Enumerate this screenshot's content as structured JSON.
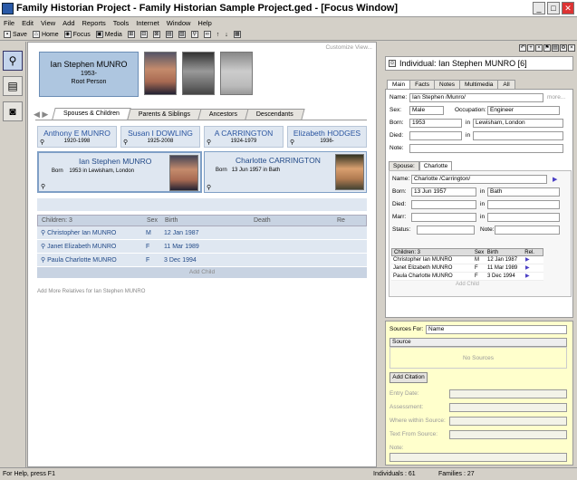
{
  "window": {
    "title": "Family Historian Project - Family Historian Sample Project.ged - [Focus Window]"
  },
  "menu": [
    "File",
    "Edit",
    "View",
    "Add",
    "Reports",
    "Tools",
    "Internet",
    "Window",
    "Help"
  ],
  "toolbar": {
    "save": "Save",
    "home": "Home",
    "focus": "Focus",
    "media": "Media"
  },
  "main": {
    "customize": "Customize View...",
    "focus": {
      "name": "Ian Stephen MUNRO",
      "dates": "1953-",
      "role": "Root Person"
    },
    "tabs": [
      "Spouses & Children",
      "Parents & Siblings",
      "Ancestors",
      "Descendants"
    ],
    "grandparents": [
      {
        "name": "Anthony E MUNRO",
        "dates": "1920-1998"
      },
      {
        "name": "Susan I DOWLING",
        "dates": "1925-2008"
      },
      {
        "name": "A CARRINGTON",
        "dates": "1924-1979"
      },
      {
        "name": "Elizabeth HODGES",
        "dates": "1936-"
      }
    ],
    "person": {
      "name": "Ian Stephen MUNRO",
      "born_label": "Born",
      "born": "1953 in Lewisham, London"
    },
    "spouse": {
      "name": "Charlotte CARRINGTON",
      "born_label": "Born",
      "born": "13 Jun 1957 in Bath"
    },
    "children_header": [
      "Children: 3",
      "Sex",
      "Birth",
      "Death",
      "Re"
    ],
    "children": [
      {
        "name": "Christopher Ian MUNRO",
        "sex": "M",
        "birth": "12 Jan 1987"
      },
      {
        "name": "Janet Elizabeth MUNRO",
        "sex": "F",
        "birth": "11 Mar 1989"
      },
      {
        "name": "Paula Charlotte MUNRO",
        "sex": "F",
        "birth": "3 Dec 1994"
      }
    ],
    "add_child": "Add Child",
    "add_more": "Add More Relatives for Ian Stephen MUNRO"
  },
  "right": {
    "title": "Individual: Ian Stephen MUNRO [6]",
    "tabs": [
      "Main",
      "Facts",
      "Notes",
      "Multimedia",
      "All"
    ],
    "labels": {
      "name": "Name:",
      "sex": "Sex:",
      "occupation": "Occupation:",
      "born": "Born:",
      "died": "Died:",
      "note": "Note:",
      "in": "in",
      "more": "more..."
    },
    "values": {
      "name": "Ian Stephen /Munro/",
      "sex": "Male",
      "occupation": "Engineer",
      "born_date": "1953",
      "born_place": "Lewisham, London"
    },
    "spouse_tabs": [
      "Spouse:",
      "Charlotte"
    ],
    "spouse": {
      "labels": {
        "name": "Name:",
        "born": "Born:",
        "died": "Died:",
        "marr": "Marr:",
        "status": "Status:",
        "note": "Note:",
        "in": "in"
      },
      "name": "Charlotte /Carrington/",
      "born_date": "13 Jun 1957",
      "born_place": "Bath"
    },
    "mini_header": [
      "Children: 3",
      "Sex",
      "Birth",
      "Rel. "
    ],
    "mini_rows": [
      {
        "name": "Christopher Ian MUNRO",
        "sex": "M",
        "birth": "12 Jan 1987"
      },
      {
        "name": "Janet Elizabeth MUNRO",
        "sex": "F",
        "birth": "11 Mar 1989"
      },
      {
        "name": "Paula Charlotte MUNRO",
        "sex": "F",
        "birth": "3 Dec 1994"
      }
    ],
    "mini_add": "Add Child",
    "sources": {
      "for_label": "Sources For:",
      "for_value": "Name",
      "col": "Source",
      "none": "No Sources",
      "add": "Add Citation",
      "fields": [
        "Entry Date:",
        "Assessment:",
        "Where within Source:",
        "Text From Source:",
        "Note:"
      ]
    }
  },
  "status": {
    "help": "For Help, press F1",
    "individuals": "Individuals : 61",
    "families": "Families : 27"
  }
}
